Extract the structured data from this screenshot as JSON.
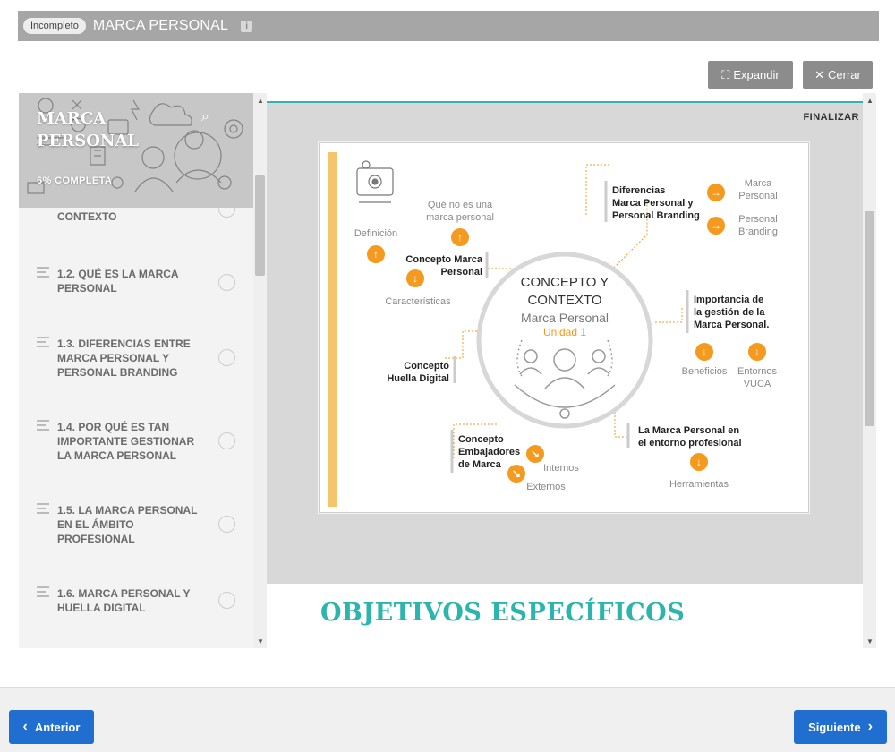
{
  "header": {
    "status_badge": "Incompleto",
    "course_title": "MARCA PERSONAL",
    "info_icon": "i"
  },
  "toolbar": {
    "expand_label": "Expandir",
    "close_label": "Cerrar",
    "expand_icon": "⛶",
    "close_icon": "✕"
  },
  "sidebar": {
    "title": "MARCA PERSONAL",
    "progress_label": "6% COMPLETA",
    "search_icon": "⌕",
    "partial_item": "CONTEXTO",
    "items": [
      {
        "label": "1.2. QUÉ ES LA MARCA PERSONAL"
      },
      {
        "label": "1.3. DIFERENCIAS ENTRE MARCA PERSONAL Y PERSONAL BRANDING"
      },
      {
        "label": "1.4. POR QUÉ ES TAN IMPORTANTE GESTIONAR LA MARCA PERSONAL"
      },
      {
        "label": "1.5. LA MARCA PERSONAL EN EL ÁMBITO PROFESIONAL"
      },
      {
        "label": "1.6. MARCA PERSONAL Y HUELLA DIGITAL"
      }
    ]
  },
  "viewer": {
    "finalizar": "FINALIZAR",
    "section_heading": "OBJETIVOS ESPECÍFICOS"
  },
  "slide": {
    "center_title_1": "CONCEPTO Y",
    "center_title_2": "CONTEXTO",
    "center_subtitle": "Marca Personal",
    "center_unit": "Unidad 1",
    "que_no_1": "Qué no es una",
    "que_no_2": "marca personal",
    "definicion": "Definición",
    "concepto_mp_1": "Concepto Marca",
    "concepto_mp_2": "Personal",
    "caracteristicas": "Características",
    "diferencias_1": "Diferencias",
    "diferencias_2": "Marca Personal y",
    "diferencias_3": "Personal Branding",
    "marca_1": "Marca",
    "marca_2": "Personal",
    "personal_branding_1": "Personal",
    "personal_branding_2": "Branding",
    "importancia_1": "Importancia de",
    "importancia_2": "la gestión de la",
    "importancia_3": "Marca Personal.",
    "beneficios": "Beneficios",
    "entornos_1": "Entornos",
    "entornos_2": "VUCA",
    "huella_1": "Concepto",
    "huella_2": "Huella Digital",
    "embajadores_1": "Concepto",
    "embajadores_2": "Embajadores",
    "embajadores_3": "de Marca",
    "internos": "Internos",
    "externos": "Externos",
    "entorno_prof_1": "La Marca Personal en",
    "entorno_prof_2": "el entorno profesional",
    "herramientas": "Herramientas",
    "accent_orange": "#f39a1f",
    "accent_bar": "#f5c56b"
  },
  "footer": {
    "prev_label": "Anterior",
    "next_label": "Siguiente"
  },
  "colors": {
    "primary_blue": "#1f6ed0",
    "teal": "#2cb5ad",
    "titlebar_gray": "#a6a6a6"
  }
}
